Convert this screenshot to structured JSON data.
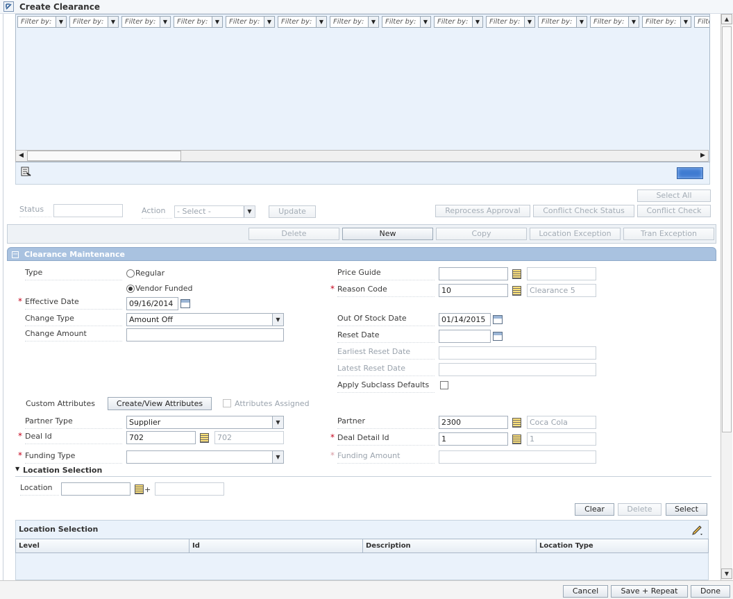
{
  "window": {
    "title": "Create Clearance"
  },
  "filters": [
    "Filter by:",
    "Filter by:",
    "Filter by:",
    "Filter by:",
    "Filter by:",
    "Filter by:",
    "Filter by:",
    "Filter by:",
    "Filter by:",
    "Filter by:",
    "Filter by:",
    "Filter by:",
    "Filter by:",
    "Filte"
  ],
  "actions": {
    "status_label": "Status",
    "status_value": "",
    "action_label": "Action",
    "action_value": "- Select -",
    "update": "Update",
    "select_all": "Select All",
    "reprocess_approval": "Reprocess Approval",
    "conflict_check_status": "Conflict Check Status",
    "conflict_check": "Conflict Check"
  },
  "toolbar": {
    "delete": "Delete",
    "new": "New",
    "copy": "Copy",
    "location_exception": "Location Exception",
    "tran_exception": "Tran Exception"
  },
  "section": {
    "title": "Clearance Maintenance"
  },
  "form": {
    "type_label": "Type",
    "type_regular": "Regular",
    "type_vendor_funded": "Vendor Funded",
    "type_selected": "Vendor Funded",
    "effective_date_label": "Effective Date",
    "effective_date": "09/16/2014",
    "change_type_label": "Change Type",
    "change_type": "Amount Off",
    "change_amount_label": "Change Amount",
    "change_amount": "",
    "price_guide_label": "Price Guide",
    "price_guide": "",
    "price_guide_desc": "",
    "reason_code_label": "Reason Code",
    "reason_code": "10",
    "reason_code_desc": "Clearance 5",
    "out_of_stock_date_label": "Out Of Stock Date",
    "out_of_stock_date": "01/14/2015",
    "reset_date_label": "Reset Date",
    "reset_date": "",
    "earliest_reset_date_label": "Earliest Reset Date",
    "earliest_reset_date": "",
    "latest_reset_date_label": "Latest Reset Date",
    "latest_reset_date": "",
    "apply_subclass_defaults_label": "Apply Subclass Defaults",
    "custom_attributes_label": "Custom Attributes",
    "create_view_attributes": "Create/View Attributes",
    "attributes_assigned_label": "Attributes Assigned",
    "partner_type_label": "Partner Type",
    "partner_type": "Supplier",
    "partner_label": "Partner",
    "partner": "2300",
    "partner_desc": "Coca Cola",
    "deal_id_label": "Deal Id",
    "deal_id": "702",
    "deal_id_desc": "702",
    "deal_detail_id_label": "Deal Detail Id",
    "deal_detail_id": "1",
    "deal_detail_id_desc": "1",
    "funding_type_label": "Funding Type",
    "funding_type": "",
    "funding_amount_label": "Funding Amount",
    "funding_amount": ""
  },
  "location_selection": {
    "header": "Location Selection",
    "location_label": "Location",
    "location_value": "",
    "location_desc": "",
    "clear": "Clear",
    "delete": "Delete",
    "select": "Select",
    "table_title": "Location Selection",
    "columns": [
      "Level",
      "Id",
      "Description",
      "Location Type"
    ]
  },
  "footer": {
    "cancel": "Cancel",
    "save_repeat": "Save + Repeat",
    "done": "Done"
  }
}
